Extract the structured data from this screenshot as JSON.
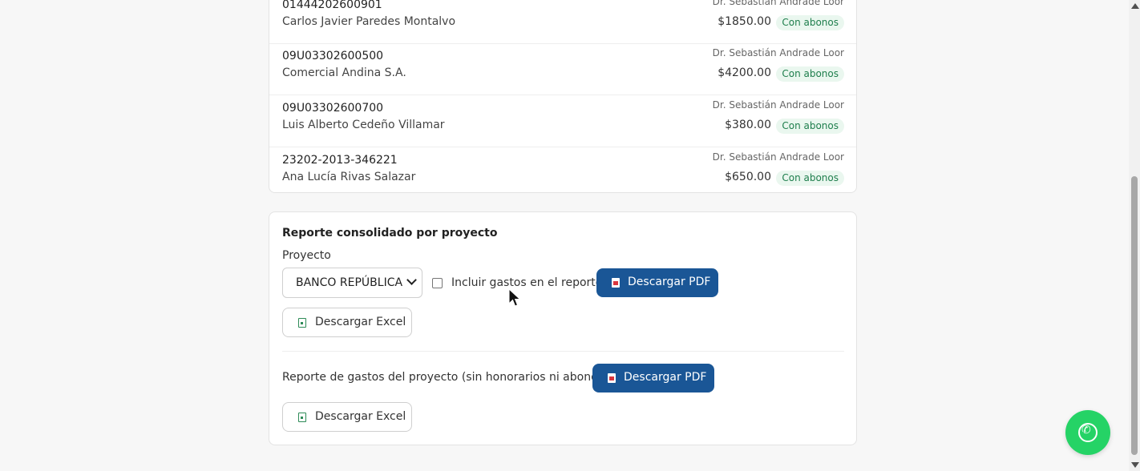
{
  "cases": [
    {
      "code": "01444202600901",
      "client": "Carlos Javier Paredes Montalvo",
      "lawyer": "Dr. Sebastián Andrade Loor",
      "amount": "$1850.00",
      "status": "Con abonos"
    },
    {
      "code": "09U03302600500",
      "client": "Comercial Andina S.A.",
      "lawyer": "Dr. Sebastián Andrade Loor",
      "amount": "$4200.00",
      "status": "Con abonos"
    },
    {
      "code": "09U03302600700",
      "client": "Luis Alberto Cedeño Villamar",
      "lawyer": "Dr. Sebastián Andrade Loor",
      "amount": "$380.00",
      "status": "Con abonos"
    },
    {
      "code": "23202-2013-346221",
      "client": "Ana Lucía Rivas Salazar",
      "lawyer": "Dr. Sebastián Andrade Loor",
      "amount": "$650.00",
      "status": "Con abonos"
    }
  ],
  "report": {
    "title": "Reporte consolidado por proyecto",
    "project_label": "Proyecto",
    "project_selected": "BANCO REPÚBLICA",
    "include_expenses_label": "Incluir gastos en el reporte",
    "include_expenses_checked": false,
    "pdf_button": "Descargar PDF",
    "excel_button": "Descargar Excel"
  },
  "expenses_report": {
    "label": "Reporte de gastos del proyecto (sin honorarios ni abonos):",
    "pdf_button": "Descargar PDF",
    "excel_button": "Descargar Excel"
  },
  "colors": {
    "primary": "#1a5696",
    "badge_text": "#1e7e4c",
    "badge_bg": "#eaf7ef",
    "whatsapp": "#25d366"
  },
  "icons": {
    "pdf": "file-pdf-icon",
    "excel": "file-excel-icon",
    "whatsapp": "whatsapp-icon"
  }
}
